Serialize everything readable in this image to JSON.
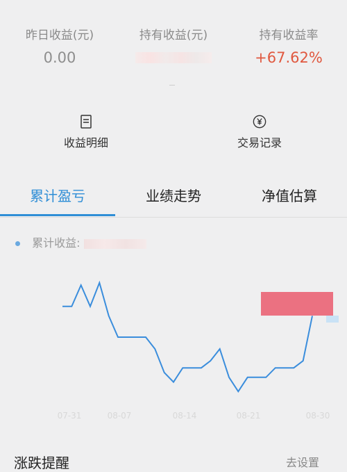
{
  "stats": {
    "yesterday_label": "昨日收益(元)",
    "yesterday_value": "0.00",
    "holding_label": "持有收益(元)",
    "holding_rate_label": "持有收益率",
    "holding_rate_value": "+67.62%"
  },
  "actions": {
    "income_detail": "收益明细",
    "trade_record": "交易记录"
  },
  "tabs": [
    "累计盈亏",
    "业绩走势",
    "净值估算"
  ],
  "legend": {
    "label": "累计收益:"
  },
  "chart_data": {
    "type": "line",
    "x_tick_labels": [
      "07-31",
      "08-07",
      "08-14",
      "08-21",
      "08-30"
    ],
    "series_color": "#3a8ddc",
    "values": [
      18,
      18,
      27,
      18,
      28,
      14,
      5,
      5,
      5,
      5,
      0,
      -10,
      -14,
      -8,
      -8,
      -8,
      -5,
      0,
      -12,
      -18,
      -12,
      -12,
      -12,
      -8,
      -8,
      -8,
      -5,
      14
    ],
    "ylim": [
      -20,
      30
    ],
    "grid": false
  },
  "bottom": {
    "left_label": "涨跌提醒",
    "right_label": "去设置"
  }
}
